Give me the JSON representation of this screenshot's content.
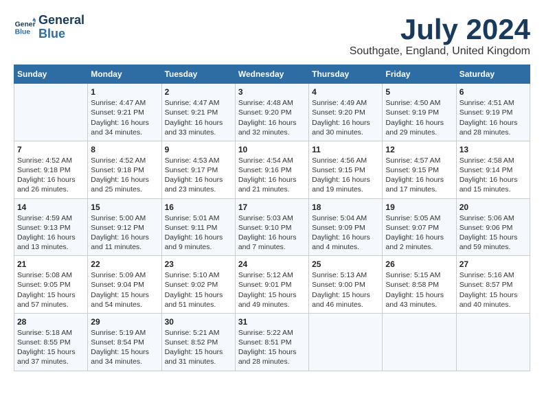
{
  "header": {
    "logo_line1": "General",
    "logo_line2": "Blue",
    "title": "July 2024",
    "subtitle": "Southgate, England, United Kingdom"
  },
  "days_of_week": [
    "Sunday",
    "Monday",
    "Tuesday",
    "Wednesday",
    "Thursday",
    "Friday",
    "Saturday"
  ],
  "weeks": [
    [
      {
        "day": "",
        "info": ""
      },
      {
        "day": "1",
        "info": "Sunrise: 4:47 AM\nSunset: 9:21 PM\nDaylight: 16 hours\nand 34 minutes."
      },
      {
        "day": "2",
        "info": "Sunrise: 4:47 AM\nSunset: 9:21 PM\nDaylight: 16 hours\nand 33 minutes."
      },
      {
        "day": "3",
        "info": "Sunrise: 4:48 AM\nSunset: 9:20 PM\nDaylight: 16 hours\nand 32 minutes."
      },
      {
        "day": "4",
        "info": "Sunrise: 4:49 AM\nSunset: 9:20 PM\nDaylight: 16 hours\nand 30 minutes."
      },
      {
        "day": "5",
        "info": "Sunrise: 4:50 AM\nSunset: 9:19 PM\nDaylight: 16 hours\nand 29 minutes."
      },
      {
        "day": "6",
        "info": "Sunrise: 4:51 AM\nSunset: 9:19 PM\nDaylight: 16 hours\nand 28 minutes."
      }
    ],
    [
      {
        "day": "7",
        "info": "Sunrise: 4:52 AM\nSunset: 9:18 PM\nDaylight: 16 hours\nand 26 minutes."
      },
      {
        "day": "8",
        "info": "Sunrise: 4:52 AM\nSunset: 9:18 PM\nDaylight: 16 hours\nand 25 minutes."
      },
      {
        "day": "9",
        "info": "Sunrise: 4:53 AM\nSunset: 9:17 PM\nDaylight: 16 hours\nand 23 minutes."
      },
      {
        "day": "10",
        "info": "Sunrise: 4:54 AM\nSunset: 9:16 PM\nDaylight: 16 hours\nand 21 minutes."
      },
      {
        "day": "11",
        "info": "Sunrise: 4:56 AM\nSunset: 9:15 PM\nDaylight: 16 hours\nand 19 minutes."
      },
      {
        "day": "12",
        "info": "Sunrise: 4:57 AM\nSunset: 9:15 PM\nDaylight: 16 hours\nand 17 minutes."
      },
      {
        "day": "13",
        "info": "Sunrise: 4:58 AM\nSunset: 9:14 PM\nDaylight: 16 hours\nand 15 minutes."
      }
    ],
    [
      {
        "day": "14",
        "info": "Sunrise: 4:59 AM\nSunset: 9:13 PM\nDaylight: 16 hours\nand 13 minutes."
      },
      {
        "day": "15",
        "info": "Sunrise: 5:00 AM\nSunset: 9:12 PM\nDaylight: 16 hours\nand 11 minutes."
      },
      {
        "day": "16",
        "info": "Sunrise: 5:01 AM\nSunset: 9:11 PM\nDaylight: 16 hours\nand 9 minutes."
      },
      {
        "day": "17",
        "info": "Sunrise: 5:03 AM\nSunset: 9:10 PM\nDaylight: 16 hours\nand 7 minutes."
      },
      {
        "day": "18",
        "info": "Sunrise: 5:04 AM\nSunset: 9:09 PM\nDaylight: 16 hours\nand 4 minutes."
      },
      {
        "day": "19",
        "info": "Sunrise: 5:05 AM\nSunset: 9:07 PM\nDaylight: 16 hours\nand 2 minutes."
      },
      {
        "day": "20",
        "info": "Sunrise: 5:06 AM\nSunset: 9:06 PM\nDaylight: 15 hours\nand 59 minutes."
      }
    ],
    [
      {
        "day": "21",
        "info": "Sunrise: 5:08 AM\nSunset: 9:05 PM\nDaylight: 15 hours\nand 57 minutes."
      },
      {
        "day": "22",
        "info": "Sunrise: 5:09 AM\nSunset: 9:04 PM\nDaylight: 15 hours\nand 54 minutes."
      },
      {
        "day": "23",
        "info": "Sunrise: 5:10 AM\nSunset: 9:02 PM\nDaylight: 15 hours\nand 51 minutes."
      },
      {
        "day": "24",
        "info": "Sunrise: 5:12 AM\nSunset: 9:01 PM\nDaylight: 15 hours\nand 49 minutes."
      },
      {
        "day": "25",
        "info": "Sunrise: 5:13 AM\nSunset: 9:00 PM\nDaylight: 15 hours\nand 46 minutes."
      },
      {
        "day": "26",
        "info": "Sunrise: 5:15 AM\nSunset: 8:58 PM\nDaylight: 15 hours\nand 43 minutes."
      },
      {
        "day": "27",
        "info": "Sunrise: 5:16 AM\nSunset: 8:57 PM\nDaylight: 15 hours\nand 40 minutes."
      }
    ],
    [
      {
        "day": "28",
        "info": "Sunrise: 5:18 AM\nSunset: 8:55 PM\nDaylight: 15 hours\nand 37 minutes."
      },
      {
        "day": "29",
        "info": "Sunrise: 5:19 AM\nSunset: 8:54 PM\nDaylight: 15 hours\nand 34 minutes."
      },
      {
        "day": "30",
        "info": "Sunrise: 5:21 AM\nSunset: 8:52 PM\nDaylight: 15 hours\nand 31 minutes."
      },
      {
        "day": "31",
        "info": "Sunrise: 5:22 AM\nSunset: 8:51 PM\nDaylight: 15 hours\nand 28 minutes."
      },
      {
        "day": "",
        "info": ""
      },
      {
        "day": "",
        "info": ""
      },
      {
        "day": "",
        "info": ""
      }
    ]
  ]
}
